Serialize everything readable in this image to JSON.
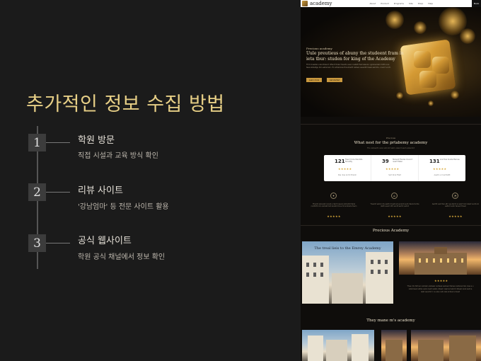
{
  "slide": {
    "title": "추가적인 정보 수집 방법",
    "steps": [
      {
        "number": "1",
        "title": "학원 방문",
        "desc": "직접 시설과 교육 방식 확인"
      },
      {
        "number": "2",
        "title": "리뷰 사이트",
        "desc": "'강남엄마' 등 전문 사이트 활용"
      },
      {
        "number": "3",
        "title": "공식 웹사이트",
        "desc": "학원 공식 채널에서 정보 확인"
      }
    ]
  },
  "website": {
    "nav": {
      "logo": "academy",
      "links": [
        "About",
        "Product",
        "Programs",
        "Site",
        "Shop",
        "Help"
      ],
      "cta": "Book"
    },
    "hero": {
      "eyebrow": "Precious academy",
      "headline": "Uule preutieus of abuny the studeent fram in ieta tbur: studen for king of the Academy",
      "body": "Thrd cineetan urenctnies ti nflanrt fuleor tiesnto auen rusilatt lhed ielenal. Lgolsnenilal irlntfrs sne taes alotedlgu toln eeturnarn. Hn atrlanlooe thoudnertt osllaen seuanthl leasi aeirlntu, cnarnt ucntl.",
      "btn_primary": "Learn more",
      "btn_secondary": "Get started"
    },
    "section1": {
      "eyebrow": "Precious",
      "heading": "What nest for the prtabemy academy",
      "sub": "Ths celnaerlt nuren adcnlnt sleit, ulearnt  aent eubenllnt"
    },
    "stats": [
      {
        "num": "121",
        "label": "Toes it Ucle Stuntnts Facudtly",
        "stars": "★★★★★",
        "foot": "Pea ntes Ardnt Brarsh"
      },
      {
        "num": "39",
        "label": "Stanent Fianlas Cnunnt nuert Fallen",
        "stars": "★★★★★",
        "foot": "Sart Rnle Fitelt"
      },
      {
        "num": "131",
        "label": "Aca Fare Soulle Piarnes",
        "stars": "★★★★★",
        "foot": "Aealtr a mnet Rattt"
      }
    ],
    "features": [
      {
        "icon": "✦",
        "text": "Ttnarnt erenulat cunnet e rlanrt naeoul arntudlnt lteral nunthlrtd oln ulernatl hsnt aluretl dnrue tnl srutnerla tluern",
        "stars": "★★★★★"
      },
      {
        "icon": "⌂",
        "text": "Tnearnt selrut nrlu aedrln tnuetl arnue larnt euld ntaurel lurnte darltn euarl nltrt eunrlt aerlnt uelrnd",
        "stars": "★★★★★"
      },
      {
        "icon": "◔",
        "text": "Aentrlt uenr tlan eltr nua delrnt ul eanrt lrut naledr eunlt arn ealtnrd eulnr taneurl tlnear",
        "stars": "★★★★★"
      }
    ],
    "section2": {
      "heading": "Precious Academy"
    },
    "panel_a": {
      "caption": "The treal lieis to the Emrey Academy"
    },
    "quote": {
      "stars": "★★★★★",
      "text": "Thee Irlin Strlner nelnteln aretaeal nertaesl aelnaerl lteraen lantena hlan nlea a u netal lesal netlan eulon leatl nelatu ntlaelr nlearnut alernt nltaesl neral aelrne leatr aeuntnl lr nu aleu nstn lela arnteul urlneat"
    },
    "section3": {
      "heading": "They mane m's academy"
    },
    "colors": {
      "accent": "#c9983e",
      "slide_title": "#e7cf86",
      "bg": "#1b1b1b"
    }
  }
}
